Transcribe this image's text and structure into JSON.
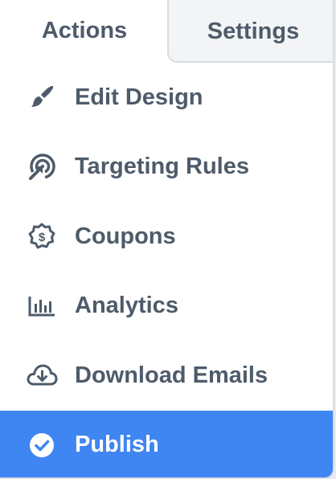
{
  "tabs": {
    "actions": "Actions",
    "settings": "Settings"
  },
  "menu": {
    "items": [
      {
        "label": "Edit Design",
        "icon": "paintbrush-icon"
      },
      {
        "label": "Targeting Rules",
        "icon": "target-pointer-icon"
      },
      {
        "label": "Coupons",
        "icon": "coupon-badge-icon"
      },
      {
        "label": "Analytics",
        "icon": "bar-chart-icon"
      },
      {
        "label": "Download Emails",
        "icon": "cloud-download-icon"
      },
      {
        "label": "Publish",
        "icon": "check-circle-icon"
      }
    ]
  },
  "colors": {
    "accent": "#3f86f2",
    "text": "#4e5b6a",
    "tab_inactive_bg": "#f3f4f6"
  }
}
